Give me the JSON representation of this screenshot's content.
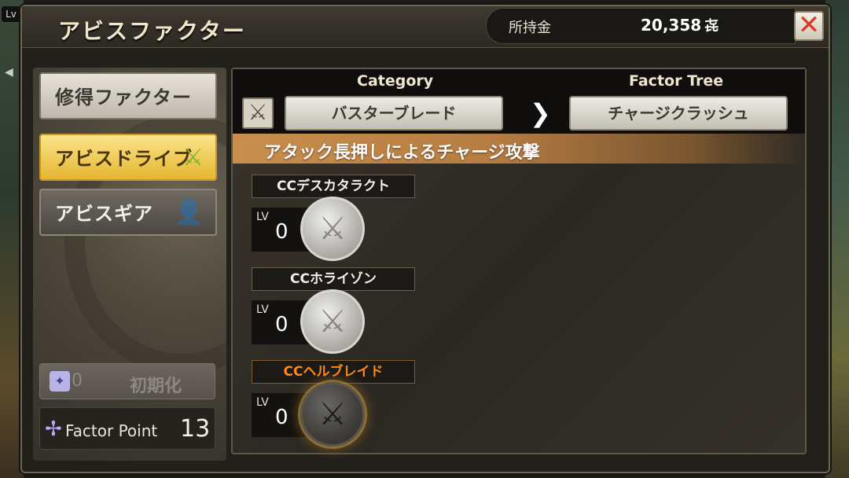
{
  "background": {
    "lv_tag": "Lv"
  },
  "header": {
    "title": "アビスファクター",
    "funds_label": "所持金",
    "funds_value": "20,358",
    "funds_unit": "㐂",
    "close_icon": "close-x-icon"
  },
  "menu": {
    "items": [
      {
        "label": "修得ファクター",
        "state": "normal"
      },
      {
        "label": "アビスドライブ",
        "state": "selected",
        "icon": "sword-icon"
      },
      {
        "label": "アビスギア",
        "state": "normal",
        "icon": "character-icon"
      }
    ],
    "reset_count": "0",
    "reset_label": "初期化",
    "factor_point_label": "Factor Point",
    "factor_point_value": "13"
  },
  "category": {
    "category_header": "Category",
    "tree_header": "Factor Tree",
    "category_value": "バスターブレード",
    "tree_value": "チャージクラッシュ",
    "separator": "❯"
  },
  "description": "アタック長押しによるチャージ攻撃",
  "skills": [
    {
      "name": "CCデスカタラクト",
      "lv_label": "LV",
      "level": "0",
      "state": "available"
    },
    {
      "name": "CCホライゾン",
      "lv_label": "LV",
      "level": "0",
      "state": "available"
    },
    {
      "name": "CCヘルブレイド",
      "lv_label": "LV",
      "level": "0",
      "state": "locked"
    }
  ],
  "colors": {
    "accent_gold": "#e4b530",
    "desc_bar": "#c88e4c",
    "locked_name": "#ff8a1a"
  }
}
